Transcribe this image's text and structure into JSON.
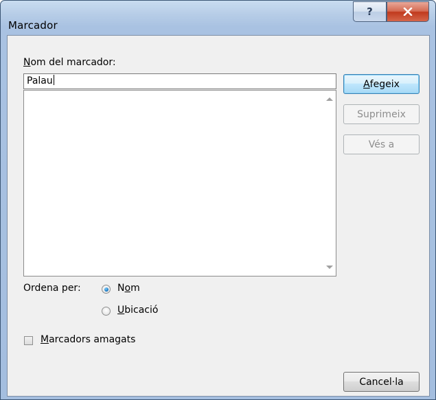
{
  "window": {
    "title": "Marcador",
    "help_glyph": "?"
  },
  "form": {
    "name_label_prefix": "N",
    "name_label_rest": "om del marcador:",
    "name_value": "Palau",
    "sort_label": "Ordena per:",
    "sort_options": [
      {
        "pre": "N",
        "underline": "o",
        "post": "m",
        "checked": true
      },
      {
        "pre": "",
        "underline": "U",
        "post": "bicació",
        "checked": false
      }
    ],
    "hidden_label_underline": "M",
    "hidden_label_rest": "arcadors amagats",
    "hidden_checked": false,
    "list_items": []
  },
  "buttons": {
    "add_underline": "A",
    "add_rest": "fegeix",
    "delete": "Suprimeix",
    "goto": "Vés a",
    "cancel": "Cancel·la"
  },
  "colors": {
    "accent": "#3c7fb1",
    "close_red": "#c0391d"
  }
}
